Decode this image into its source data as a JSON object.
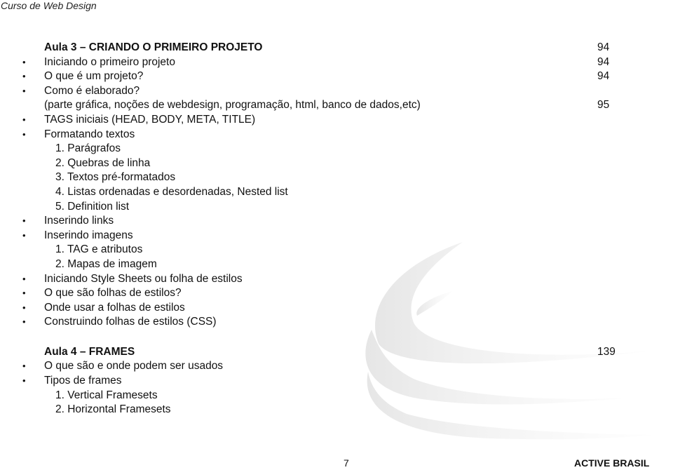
{
  "header": {
    "title": "Curso de Web Design"
  },
  "sections": [
    {
      "heading": "Aula 3 – CRIANDO O PRIMEIRO PROJETO",
      "page": "94",
      "items": [
        {
          "type": "bullet",
          "text": "Iniciando o primeiro projeto",
          "page": "94"
        },
        {
          "type": "bullet",
          "text": "O que é um projeto?",
          "page": "94"
        },
        {
          "type": "bullet",
          "text": "Como é elaborado?",
          "page": ""
        },
        {
          "type": "continuation",
          "text": " (parte gráfica, noções de webdesign, programação, html, banco de dados,etc)",
          "page": "95"
        },
        {
          "type": "bullet",
          "text": "TAGS iniciais (HEAD, BODY, META, TITLE)",
          "page": ""
        },
        {
          "type": "bullet",
          "text": "Formatando textos",
          "page": ""
        },
        {
          "type": "sub",
          "text": "1. Parágrafos",
          "page": ""
        },
        {
          "type": "sub",
          "text": "2. Quebras de linha",
          "page": ""
        },
        {
          "type": "sub",
          "text": "3. Textos pré-formatados",
          "page": ""
        },
        {
          "type": "sub",
          "text": "4. Listas ordenadas e desordenadas, Nested list",
          "page": ""
        },
        {
          "type": "sub",
          "text": "5. Definition list",
          "page": ""
        },
        {
          "type": "bullet",
          "text": "Inserindo links",
          "page": ""
        },
        {
          "type": "bullet",
          "text": "Inserindo imagens",
          "page": ""
        },
        {
          "type": "sub",
          "text": "1. TAG e atributos",
          "page": ""
        },
        {
          "type": "sub",
          "text": "2. Mapas de imagem",
          "page": ""
        },
        {
          "type": "bullet",
          "text": "Iniciando Style Sheets ou folha de estilos",
          "page": ""
        },
        {
          "type": "bullet",
          "text": "O que são folhas de estilos?",
          "page": ""
        },
        {
          "type": "bullet",
          "text": "Onde usar a folhas de estilos",
          "page": ""
        },
        {
          "type": "bullet",
          "text": "Construindo folhas de estilos (CSS)",
          "page": ""
        }
      ]
    },
    {
      "heading": "Aula 4 – FRAMES",
      "page": "139",
      "items": [
        {
          "type": "bullet",
          "text": "O que são e onde podem ser usados",
          "page": ""
        },
        {
          "type": "bullet",
          "text": "Tipos de frames",
          "page": ""
        },
        {
          "type": "sub",
          "text": "1. Vertical Framesets",
          "page": ""
        },
        {
          "type": "sub",
          "text": "2. Horizontal Framesets",
          "page": ""
        }
      ]
    }
  ],
  "bullet_glyph": "•",
  "watermark": {
    "icon": "swoosh-watermark-icon",
    "color": "#eeeeee"
  },
  "footer": {
    "page_number": "7",
    "brand": "ACTIVE BRASIL"
  }
}
